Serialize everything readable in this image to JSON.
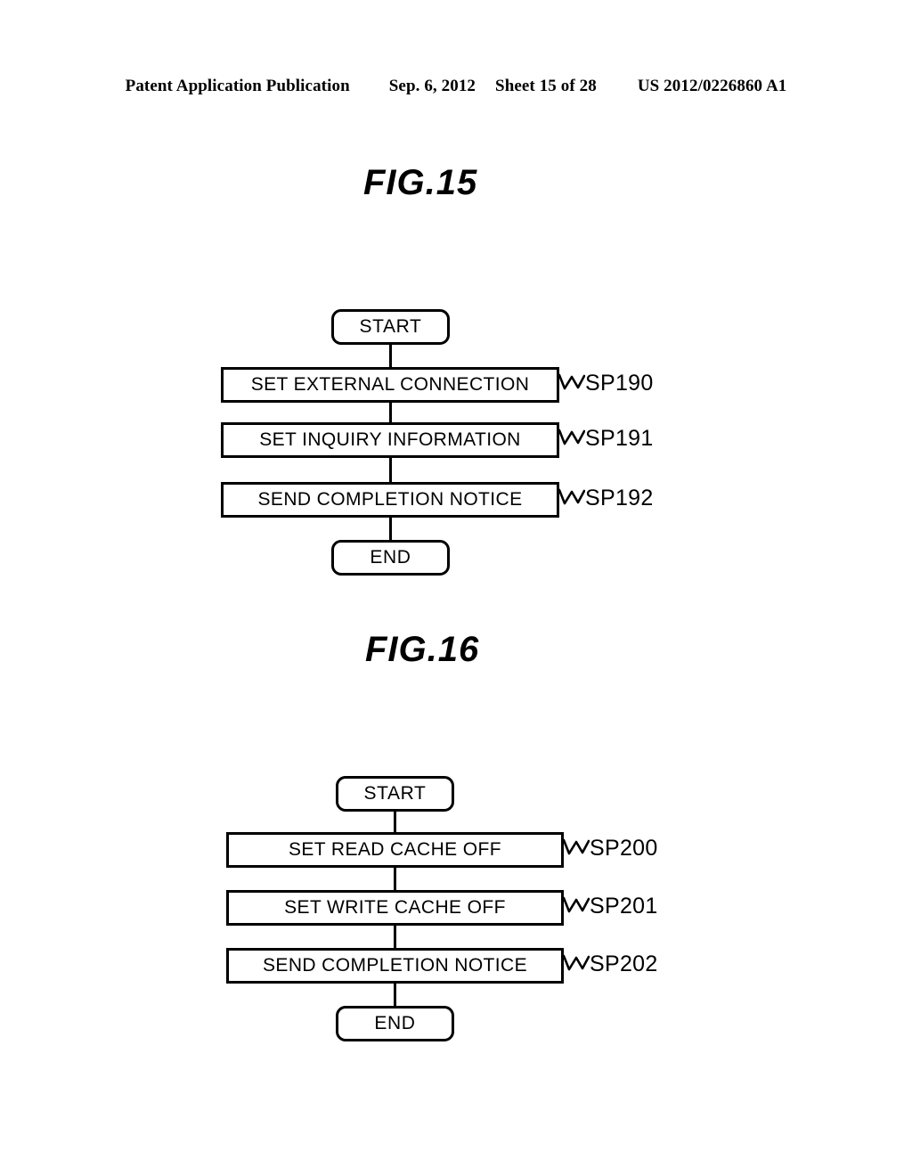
{
  "header": {
    "publication": "Patent Application Publication",
    "date": "Sep. 6, 2012",
    "sheet": "Sheet 15 of 28",
    "patent_number": "US 2012/0226860 A1"
  },
  "figures": [
    {
      "title": "FIG.15",
      "start_label": "START",
      "end_label": "END",
      "steps": [
        {
          "text": "SET EXTERNAL CONNECTION",
          "step_id": "SP190"
        },
        {
          "text": "SET INQUIRY INFORMATION",
          "step_id": "SP191"
        },
        {
          "text": "SEND COMPLETION NOTICE",
          "step_id": "SP192"
        }
      ]
    },
    {
      "title": "FIG.16",
      "start_label": "START",
      "end_label": "END",
      "steps": [
        {
          "text": "SET READ CACHE OFF",
          "step_id": "SP200"
        },
        {
          "text": "SET WRITE CACHE OFF",
          "step_id": "SP201"
        },
        {
          "text": "SEND COMPLETION NOTICE",
          "step_id": "SP202"
        }
      ]
    }
  ],
  "colors": {
    "ink": "#000000",
    "paper": "#ffffff"
  }
}
